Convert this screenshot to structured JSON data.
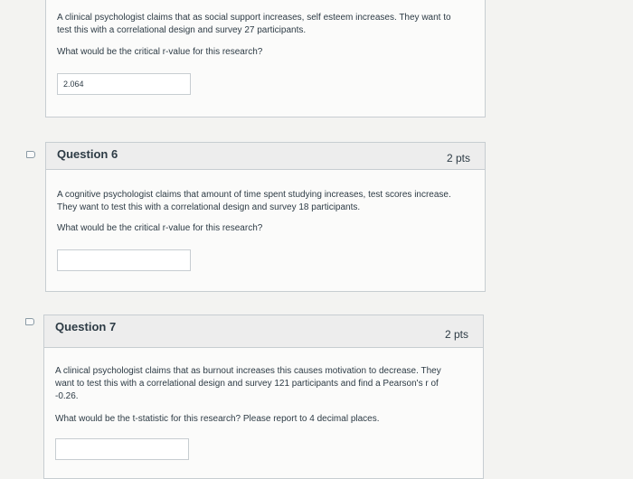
{
  "q5": {
    "prompt_line1": "A clinical psychologist claims that as social support increases, self esteem increases. They want to",
    "prompt_line2": "test this with a correlational design and survey 27 participants.",
    "question": "What would be the critical r-value for this research?",
    "answer_value": "2.064"
  },
  "q6": {
    "title": "Question 6",
    "points": "2 pts",
    "prompt_line1": "A cognitive psychologist claims that amount of time spent studying increases, test scores increase.",
    "prompt_line2": "They want to test this with a correlational design and survey 18 participants.",
    "question": "What would be the critical r-value for this research?",
    "answer_value": ""
  },
  "q7": {
    "title": "Question 7",
    "points": "2 pts",
    "prompt_line1": "A clinical psychologist claims that as burnout increases this causes motivation to decrease. They",
    "prompt_line2": "want to test this with a correlational design and survey 121 participants and find a Pearson's r of",
    "prompt_line3": "-0.26.",
    "question": "What would be the t-statistic for this research? Please report to 4 decimal places.",
    "answer_value": ""
  }
}
